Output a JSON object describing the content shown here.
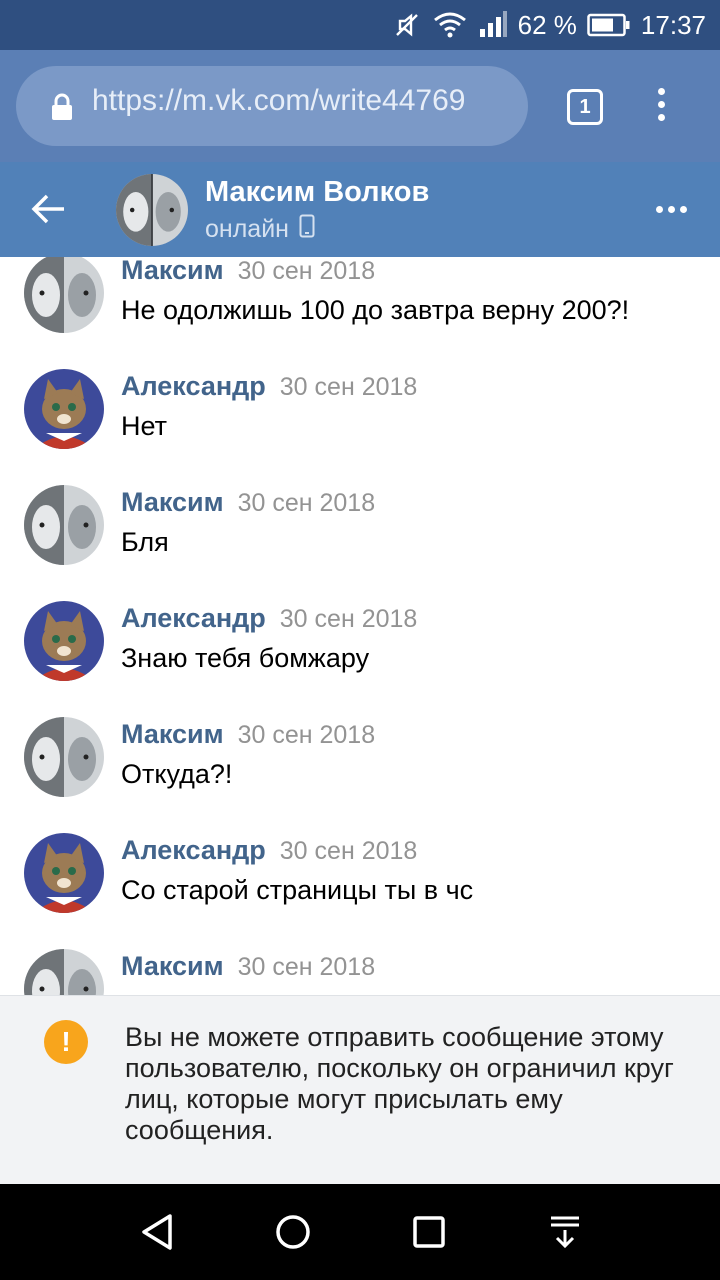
{
  "status_bar": {
    "battery": "62 %",
    "time": "17:37",
    "icons": [
      "mute-icon",
      "wifi-icon",
      "signal-icon",
      "battery-icon"
    ]
  },
  "browser": {
    "url": "https://m.vk.com/write44769",
    "tab_count": "1",
    "icons": [
      "lock-icon",
      "tabs-icon",
      "overflow-menu-icon"
    ]
  },
  "chat": {
    "contact_name": "Максим Волков",
    "status": "онлайн",
    "icons": [
      "back-arrow-icon",
      "mobile-icon",
      "more-icon"
    ]
  },
  "messages": [
    {
      "author": "Максим",
      "date": "30 сен 2018",
      "text": "Не одолжишь 100 до завтра верну 200?!",
      "avatar": "maxim"
    },
    {
      "author": "Александр",
      "date": "30 сен 2018",
      "text": "Нет",
      "avatar": "alexander"
    },
    {
      "author": "Максим",
      "date": "30 сен 2018",
      "text": "Бля",
      "avatar": "maxim"
    },
    {
      "author": "Александр",
      "date": "30 сен 2018",
      "text": "Знаю тебя бомжару",
      "avatar": "alexander"
    },
    {
      "author": "Максим",
      "date": "30 сен 2018",
      "text": "Откуда?!",
      "avatar": "maxim"
    },
    {
      "author": "Александр",
      "date": "30 сен 2018",
      "text": "Со старой страницы ты в чс",
      "avatar": "alexander"
    },
    {
      "author": "Максим",
      "date": "30 сен 2018",
      "text": "",
      "avatar": "maxim"
    }
  ],
  "notice": {
    "icon_glyph": "!",
    "text": "Вы не можете отправить сообщение этому пользователю, поскольку он ограничил круг лиц, которые могут присылать ему сообщения."
  },
  "nav_bar": {
    "icons": [
      "back-triangle-icon",
      "home-circle-icon",
      "recents-square-icon",
      "notification-pull-icon"
    ]
  },
  "colors": {
    "status_bar": "#2f4f80",
    "browser_bar": "#5b7fb5",
    "chat_header": "#5181b8",
    "author_name": "#42648b",
    "warning": "#f8a51c"
  }
}
